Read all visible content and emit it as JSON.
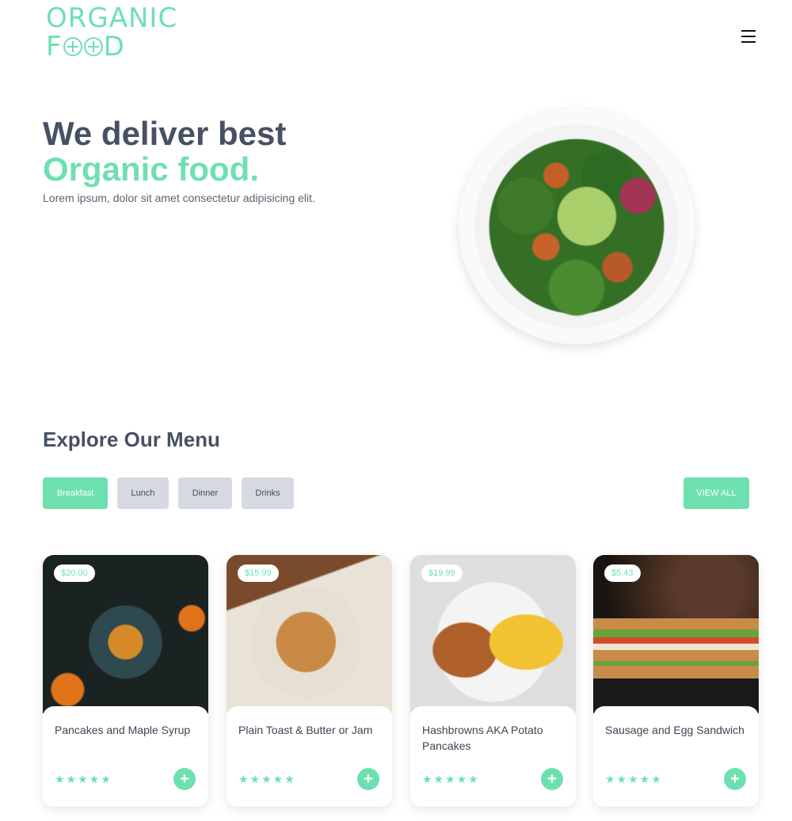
{
  "brand": {
    "line1": "ORGANIC",
    "line2_start": "F",
    "line2_end": "D"
  },
  "hero": {
    "title_line1": "We deliver best",
    "title_line2": "Organic food.",
    "subtitle": "Lorem ipsum, dolor sit amet consectetur adipisicing elit."
  },
  "menu": {
    "title": "Explore Our Menu",
    "tabs": [
      {
        "label": "Breakfast",
        "active": true
      },
      {
        "label": "Lunch",
        "active": false
      },
      {
        "label": "Dinner",
        "active": false
      },
      {
        "label": "Drinks",
        "active": false
      }
    ],
    "view_all": "VIEW ALL"
  },
  "cards": [
    {
      "price": "$20.00",
      "title": "Pancakes and Maple Syrup",
      "stars": "★★★★★",
      "add": "+"
    },
    {
      "price": "$15.99",
      "title": "Plain Toast & Butter or Jam",
      "stars": "★★★★★",
      "add": "+"
    },
    {
      "price": "$19.99",
      "title": "Hashbrowns AKA Potato Pancakes",
      "stars": "★★★★★",
      "add": "+"
    },
    {
      "price": "$5.43",
      "title": "Sausage and Egg Sandwich",
      "stars": "★★★★★",
      "add": "+"
    }
  ],
  "colors": {
    "accent": "#6ee0b0",
    "heading": "#465163",
    "tab_inactive": "#d6d9e1"
  },
  "icons": {
    "menu": "hamburger-icon",
    "add": "plus-icon",
    "rating": "star-icon"
  }
}
